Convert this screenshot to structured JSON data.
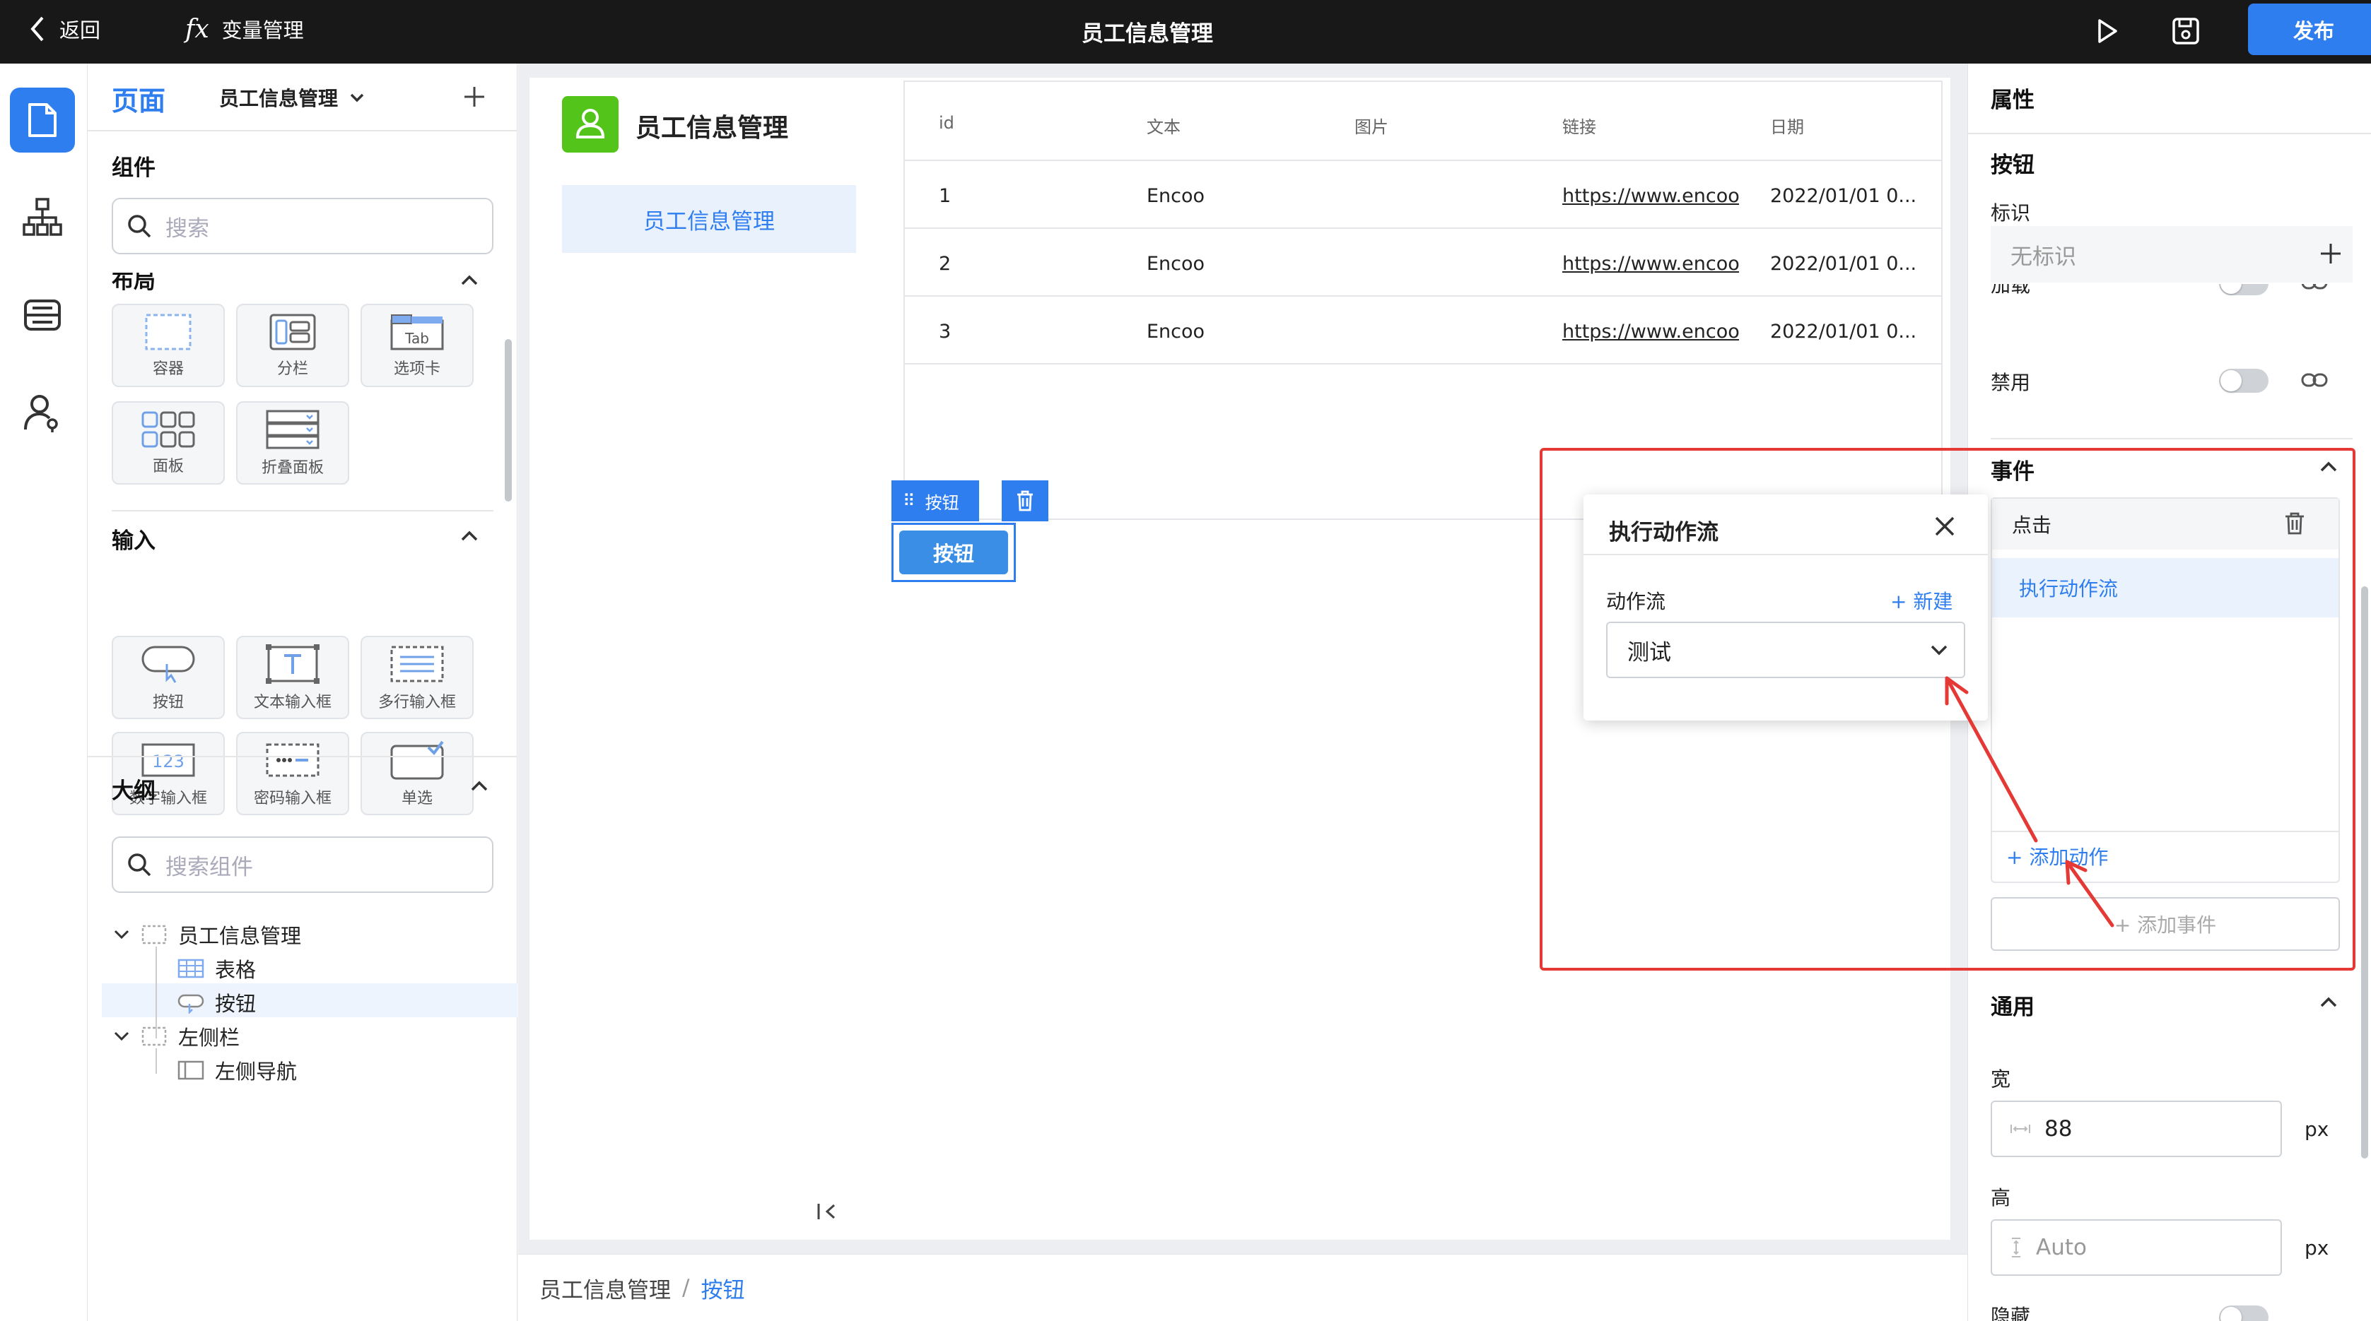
{
  "topbar": {
    "back_label": "返回",
    "var_label": "变量管理",
    "title": "员工信息管理",
    "publish_label": "发布"
  },
  "left": {
    "page_tab": "页面",
    "page_select": "员工信息管理",
    "components_title": "组件",
    "search_placeholder": "搜索",
    "layout_title": "布局",
    "layout_items": [
      "容器",
      "分栏",
      "选项卡",
      "面板",
      "折叠面板"
    ],
    "tab_glyph": "Tab",
    "input_title": "输入",
    "input_items": [
      "按钮",
      "文本输入框",
      "多行输入框",
      "数字输入框",
      "密码输入框",
      "单选"
    ],
    "num_glyph": "123",
    "outline_title": "大纲",
    "outline_search": "搜索组件",
    "tree": [
      "员工信息管理",
      "表格",
      "按钮",
      "左侧栏",
      "左侧导航"
    ]
  },
  "canvas": {
    "app_title": "员工信息管理",
    "nav_item": "员工信息管理",
    "table": {
      "headers": [
        "id",
        "文本",
        "图片",
        "链接",
        "日期"
      ],
      "rows": [
        [
          "1",
          "Encoo",
          "",
          "https://www.encoo.c",
          "2022/01/01 0..."
        ],
        [
          "2",
          "Encoo",
          "",
          "https://www.encoo.c",
          "2022/01/01 0..."
        ],
        [
          "3",
          "Encoo",
          "",
          "https://www.encoo.c",
          "2022/01/01 0..."
        ]
      ]
    },
    "selected_tag": "按钮",
    "button_label": "按钮",
    "breadcrumb": [
      "员工信息管理",
      "按钮"
    ],
    "breadcrumb_sep": "/"
  },
  "dialog": {
    "title": "执行动作流",
    "field_label": "动作流",
    "new_label": "+ 新建",
    "selected": "测试"
  },
  "right": {
    "title": "属性",
    "component": "按钮",
    "id_label": "标识",
    "id_placeholder": "无标识",
    "loading_label": "加载",
    "disabled_label": "禁用",
    "events_title": "事件",
    "event_name": "点击",
    "action_item": "执行动作流",
    "add_action": "+ 添加动作",
    "add_event": "+ 添加事件",
    "general_title": "通用",
    "width_label": "宽",
    "width_value": "88",
    "height_label": "高",
    "height_placeholder": "Auto",
    "unit": "px",
    "hidden_label": "隐藏"
  },
  "colors": {
    "accent": "#2f7ef0",
    "highlight": "#e53935",
    "app_icon": "#52c41a"
  }
}
